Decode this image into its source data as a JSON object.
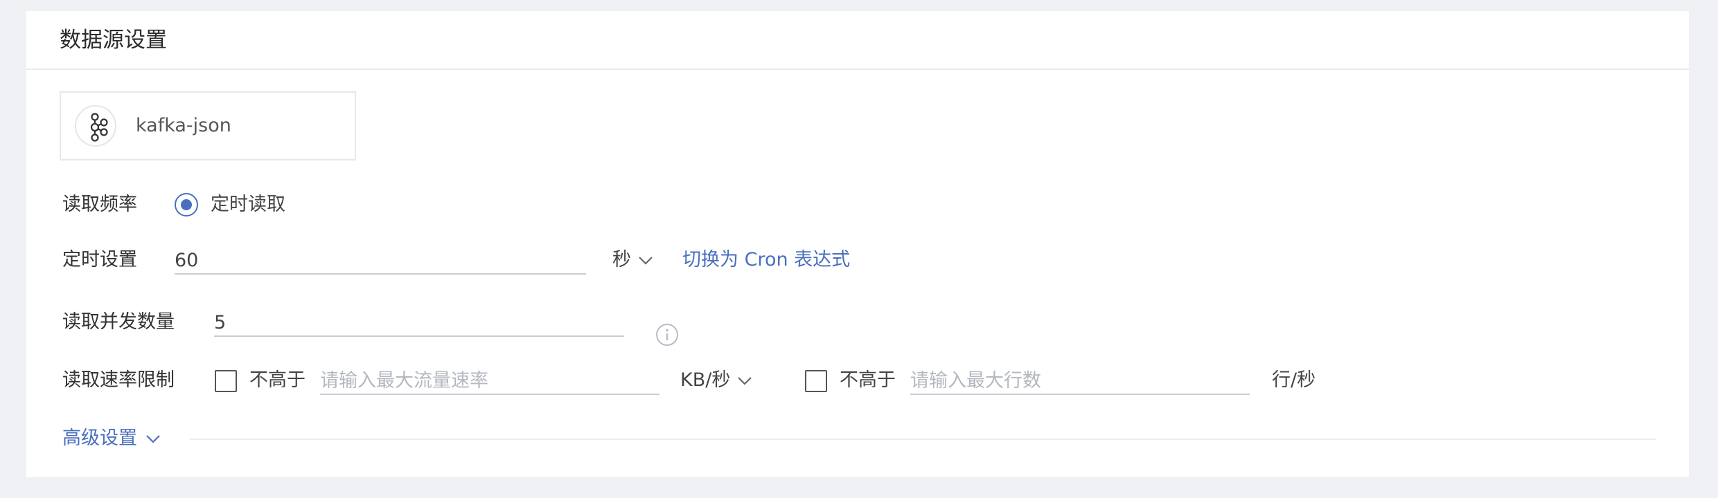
{
  "panel": {
    "title": "数据源设置"
  },
  "source": {
    "name": "kafka-json",
    "icon": "kafka-icon"
  },
  "read_frequency": {
    "label": "读取频率",
    "option_label": "定时读取",
    "selected": true
  },
  "schedule": {
    "label": "定时设置",
    "value": "60",
    "unit": "秒",
    "switch_link": "切换为 Cron 表达式"
  },
  "concurrency": {
    "label": "读取并发数量",
    "value": "5",
    "info_icon": "info-icon"
  },
  "rate_limit": {
    "label": "读取速率限制",
    "flow": {
      "checkbox_label": "不高于",
      "placeholder": "请输入最大流量速率",
      "value": "",
      "unit": "KB/秒"
    },
    "rows": {
      "checkbox_label": "不高于",
      "placeholder": "请输入最大行数",
      "value": "",
      "unit": "行/秒"
    }
  },
  "advanced": {
    "label": "高级设置"
  },
  "colors": {
    "accent": "#4a6fbe",
    "background": "#f0f1f5",
    "panel": "#ffffff",
    "divider": "#e8eaef"
  }
}
